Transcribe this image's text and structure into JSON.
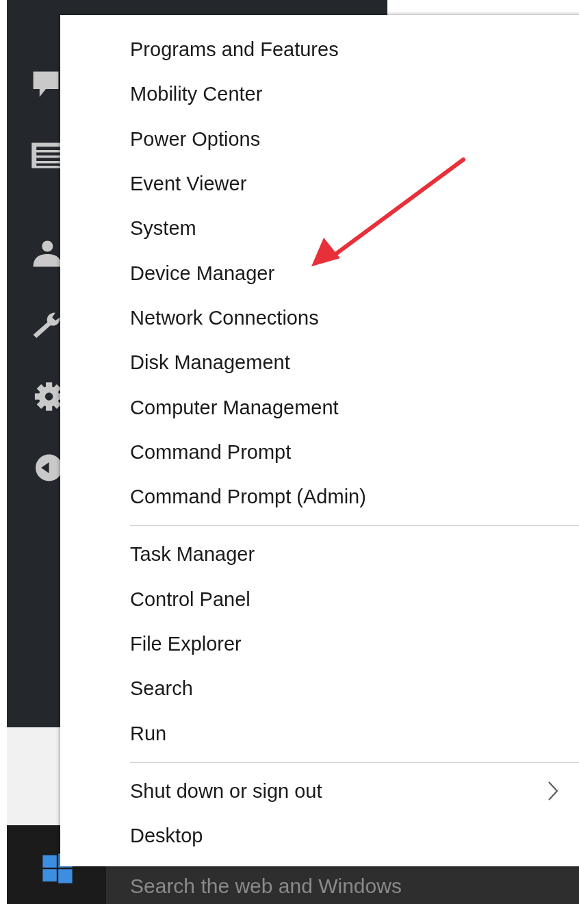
{
  "menu": {
    "sections": [
      {
        "items": [
          {
            "label": "Programs and Features",
            "submenu": false
          },
          {
            "label": "Mobility Center",
            "submenu": false
          },
          {
            "label": "Power Options",
            "submenu": false
          },
          {
            "label": "Event Viewer",
            "submenu": false
          },
          {
            "label": "System",
            "submenu": false
          },
          {
            "label": "Device Manager",
            "submenu": false
          },
          {
            "label": "Network Connections",
            "submenu": false
          },
          {
            "label": "Disk Management",
            "submenu": false
          },
          {
            "label": "Computer Management",
            "submenu": false
          },
          {
            "label": "Command Prompt",
            "submenu": false
          },
          {
            "label": "Command Prompt (Admin)",
            "submenu": false
          }
        ]
      },
      {
        "items": [
          {
            "label": "Task Manager",
            "submenu": false
          },
          {
            "label": "Control Panel",
            "submenu": false
          },
          {
            "label": "File Explorer",
            "submenu": false
          },
          {
            "label": "Search",
            "submenu": false
          },
          {
            "label": "Run",
            "submenu": false
          }
        ]
      },
      {
        "items": [
          {
            "label": "Shut down or sign out",
            "submenu": true
          },
          {
            "label": "Desktop",
            "submenu": false
          }
        ]
      }
    ]
  },
  "taskbar": {
    "search": {
      "placeholder": "Search the web and Windows"
    }
  }
}
